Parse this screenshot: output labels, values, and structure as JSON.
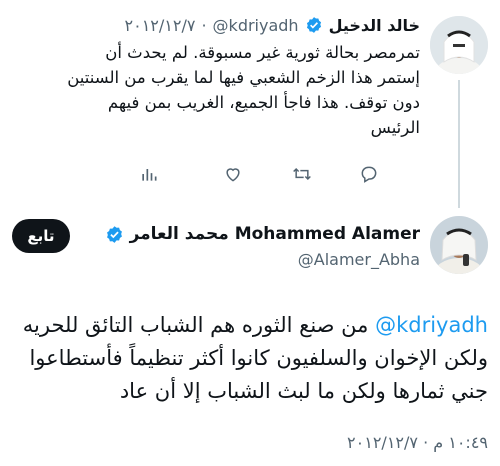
{
  "reply_context": {
    "author_name": "خالد الدخيل",
    "handle": "@kdriyadh",
    "date": "٢٠١٢/١٢/٧",
    "lines": [
      "تمرمصر  بحالة ثورية غير مسبوقة. لم يحدث أن",
      "إستمر هذا الزخم الشعبي فيها لما يقرب من السنتين",
      "دون توقف. هذا فاجأ الجميع، الغريب بمن فيهم",
      "الرئيس"
    ]
  },
  "main_tweet": {
    "display_name": "محمد العامر Mohammed Alamer",
    "handle": "@Alamer_Abha",
    "follow_label": "تابع",
    "mention": "@kdriyadh",
    "line1_rest": " من صنع الثوره هم الشباب التائق للحريه",
    "line2": "ولكن الإخوان والسلفيون كانوا أكثر تنظيماً فأستطاعوا",
    "line3": "جني ثمارها ولكن ما لبث الشباب إلا أن عاد",
    "timestamp": "١٠:٤٩ م · ٢٠١٢/١٢/٧"
  },
  "colors": {
    "accent": "#1d9bf0",
    "text": "#0f1419",
    "muted": "#536471"
  },
  "icons": [
    "verified-badge-icon",
    "reply-icon",
    "retweet-icon",
    "like-icon",
    "views-icon"
  ]
}
